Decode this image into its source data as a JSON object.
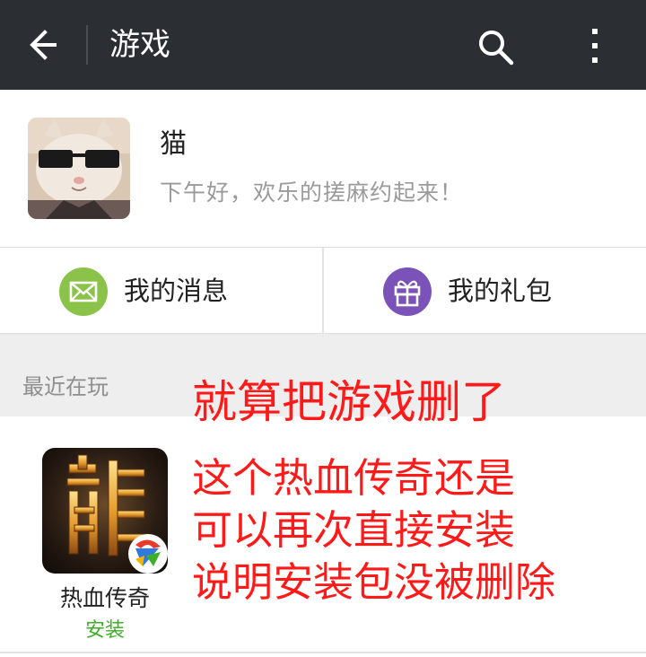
{
  "header": {
    "title": "游戏",
    "back_icon": "arrow-left-icon",
    "search_icon": "search-icon",
    "more_icon": "more-vertical-icon"
  },
  "profile": {
    "name": "猫",
    "greeting": "下午好，欢乐的搓麻约起来！",
    "avatar_icon": "cat-sunglasses-avatar"
  },
  "quick_actions": [
    {
      "label": "我的消息",
      "icon": "mail-icon",
      "color": "#8bc34a"
    },
    {
      "label": "我的礼包",
      "icon": "gift-icon",
      "color": "#7a52b8"
    }
  ],
  "recent": {
    "label": "最近在玩",
    "games": [
      {
        "name": "热血传奇",
        "action": "安装",
        "icon": "dragon-game-icon",
        "action_color": "#3fae29"
      }
    ]
  },
  "overlay_caption": {
    "line1": "就算把游戏删了",
    "line2": "这个热血传奇还是",
    "line3": "可以再次直接安装",
    "line4": "说明安装包没被删除",
    "color": "#ff1a1a"
  },
  "colors": {
    "header_bg": "#2b2e33",
    "section_bg": "#eeeeee"
  }
}
